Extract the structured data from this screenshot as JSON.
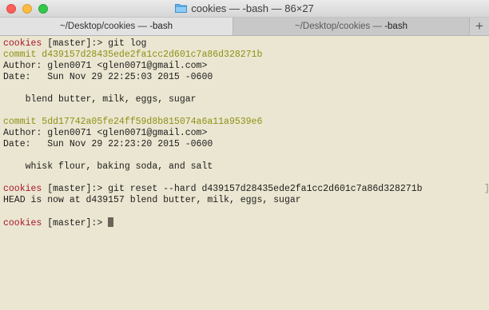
{
  "window": {
    "title": "cookies — -bash — 86×27"
  },
  "tabs": [
    {
      "prefix": "~/Desktop/cookies — ",
      "suffix": "-bash"
    },
    {
      "prefix": "~/Desktop/cookies — ",
      "suffix": "-bash"
    }
  ],
  "new_tab_label": "+",
  "colors": {
    "prompt_dir": "#a8162a",
    "commit_hash": "#8d9116",
    "background": "#ebe6d1"
  },
  "terminal": {
    "prompt_dir": "cookies",
    "prompt_rest": " [master]:> ",
    "cmd1": "git log",
    "commit1": "commit d439157d28435ede2fa1cc2d601c7a86d328271b",
    "author1": "Author: glen0071 <glen0071@gmail.com>",
    "date1": "Date:   Sun Nov 29 22:25:03 2015 -0600",
    "msg1": "    blend butter, milk, eggs, sugar",
    "commit2": "commit 5dd17742a05fe24ff59d8b815074a6a11a9539e6",
    "author2": "Author: glen0071 <glen0071@gmail.com>",
    "date2": "Date:   Sun Nov 29 22:23:20 2015 -0600",
    "msg2": "    whisk flour, baking soda, and salt",
    "cmd2": "git reset --hard d439157d28435ede2fa1cc2d601c7a86d328271b",
    "output": "HEAD is now at d439157 blend butter, milk, eggs, sugar",
    "end_marker": "]"
  }
}
